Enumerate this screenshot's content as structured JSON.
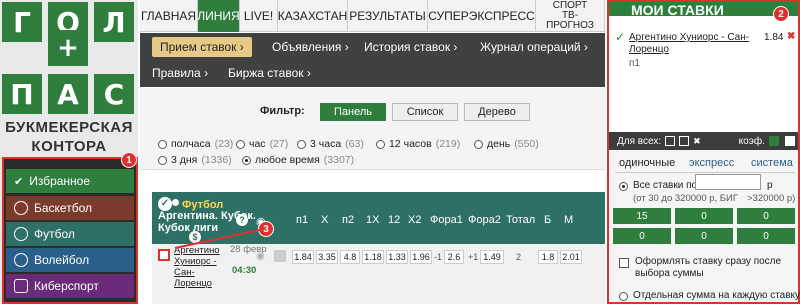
{
  "brand": {
    "tiles": [
      "Г",
      "О",
      "Л",
      "+",
      "П",
      "А",
      "С"
    ],
    "line1": "БУКМЕКЕРСКАЯ",
    "line2": "КОНТОРА"
  },
  "left_menu": [
    {
      "label": "Избранное",
      "icon": "check-icon",
      "color": "#2f7e3e"
    },
    {
      "label": "Баскетбол",
      "icon": "basketball-icon",
      "color": "#7b3b2c"
    },
    {
      "label": "Футбол",
      "icon": "football-icon",
      "color": "#2f7e3e"
    },
    {
      "label": "Волейбол",
      "icon": "volleyball-icon",
      "color": "#2a5f8a"
    },
    {
      "label": "Киберспорт",
      "icon": "gamepad-icon",
      "color": "#6b2b7a"
    }
  ],
  "topnav": {
    "items": [
      "ГЛАВНАЯ",
      "ЛИНИЯ",
      "LIVE!",
      "КАЗАХСТАН",
      "РЕЗУЛЬТАТЫ",
      "СУПЕРЭКСПРЕСС"
    ],
    "spr_line1": "СПОРТ",
    "spr_line2": "ТВ-",
    "spr_line3": "ПРОГНОЗ"
  },
  "subnav": {
    "row1": [
      "Прием ставок",
      "Объявления",
      "История ставок",
      "Журнал операций"
    ],
    "row2": [
      "Правила",
      "Биржа ставок"
    ]
  },
  "filter": {
    "label": "Фильтр:",
    "buttons": [
      "Панель",
      "Список",
      "Дерево"
    ],
    "radios": [
      {
        "label": "полчаса",
        "count": "(23)"
      },
      {
        "label": "час",
        "count": "(27)"
      },
      {
        "label": "3 часа",
        "count": "(63)"
      },
      {
        "label": "12 часов",
        "count": "(219)"
      },
      {
        "label": "день",
        "count": "(550)"
      },
      {
        "label": "3 дня",
        "count": "(1336)"
      },
      {
        "label": "любое время",
        "count": "(3307)"
      }
    ]
  },
  "events": {
    "sport": "Футбол",
    "competition": "Аргентина. Кубок. Кубок лиги",
    "dollar": "$",
    "columns": [
      "п1",
      "Х",
      "п2",
      "1Х",
      "12",
      "Х2",
      "Фора1",
      "Фора2",
      "Тотал",
      "Б",
      "М"
    ],
    "row": {
      "team": "Аргентино Хуниорс - Сан-Лоренцо",
      "date": "28 февр",
      "time": "04:30",
      "odds": [
        "1.84",
        "3.35",
        "4.8",
        "1.18",
        "1.33",
        "1.96",
        "2.6",
        "1.49",
        "1.8",
        "2.01"
      ],
      "handicaps": [
        "-1",
        "+1",
        "2"
      ]
    }
  },
  "slip": {
    "title": "МОИ СТАВКИ",
    "bet_team": "Аргентино Хуниорс - Сан-Лоренцо",
    "bet_outcome": "п1",
    "bet_odds": "1.84",
    "for_all": "Для всех:",
    "coef": "коэф.",
    "tabs": [
      "одиночные",
      "экспресс",
      "система"
    ],
    "all_bets_label": "Все ставки по",
    "all_bets_suffix": "р",
    "limits": "(от 30 до 320000 р, БИГ",
    "limits2": ">320000 р)",
    "stake_buttons": [
      "15",
      "0",
      "0",
      "0",
      "0",
      "0"
    ],
    "opt1": "Оформлять ставку сразу после выбора суммы",
    "opt2": "Отдельная сумма на каждую ставку"
  },
  "badges": [
    "1",
    "2",
    "3"
  ],
  "colors": {
    "green": "#2f7e3e",
    "dark": "#3f4240",
    "red": "#e0302b",
    "gold": "#e7c986",
    "teal": "#2e6f66"
  }
}
